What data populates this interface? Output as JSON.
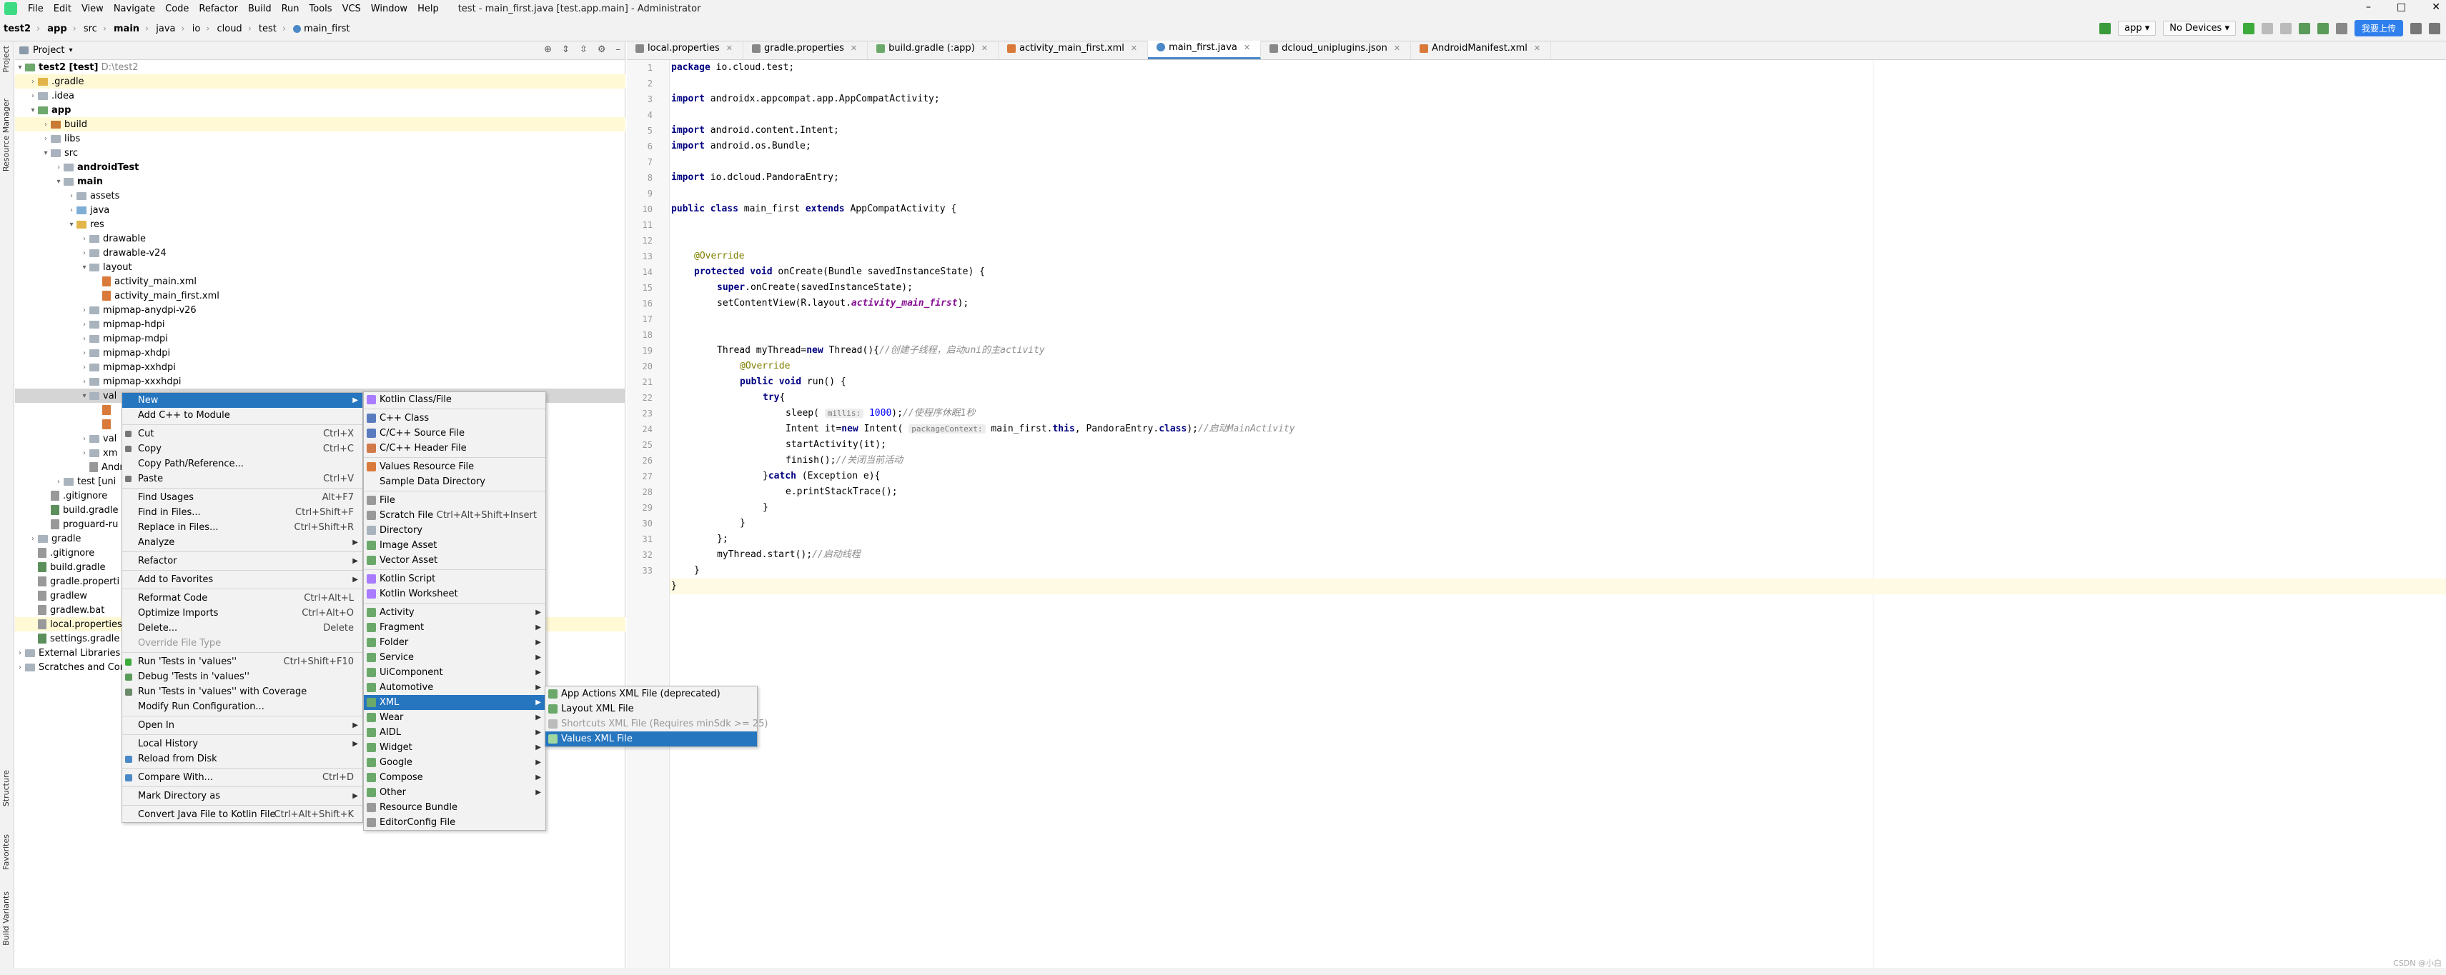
{
  "menubar": {
    "items": [
      "File",
      "Edit",
      "View",
      "Navigate",
      "Code",
      "Refactor",
      "Build",
      "Run",
      "Tools",
      "VCS",
      "Window",
      "Help"
    ],
    "title": "test - main_first.java [test.app.main] - Administrator"
  },
  "breadcrumbs": [
    "test2",
    "app",
    "src",
    "main",
    "java",
    "io",
    "cloud",
    "test",
    "main_first"
  ],
  "toolbar": {
    "config": "app",
    "device": "No Devices",
    "upload": "我要上传"
  },
  "side_tabs": {
    "project": "Project",
    "resource_manager": "Resource Manager",
    "structure": "Structure",
    "favorites": "Favorites",
    "build_variants": "Build Variants"
  },
  "project": {
    "header": "Project",
    "tree": [
      {
        "label": "test2 [test]",
        "hint": "D:\\test2",
        "bold": true
      },
      {
        "label": ".gradle"
      },
      {
        "label": ".idea"
      },
      {
        "label": "app",
        "bold": true
      },
      {
        "label": "build"
      },
      {
        "label": "libs"
      },
      {
        "label": "src"
      },
      {
        "label": "androidTest",
        "bold": true
      },
      {
        "label": "main",
        "bold": true
      },
      {
        "label": "assets"
      },
      {
        "label": "java"
      },
      {
        "label": "res"
      },
      {
        "label": "drawable"
      },
      {
        "label": "drawable-v24"
      },
      {
        "label": "layout"
      },
      {
        "label": "activity_main.xml"
      },
      {
        "label": "activity_main_first.xml"
      },
      {
        "label": "mipmap-anydpi-v26"
      },
      {
        "label": "mipmap-hdpi"
      },
      {
        "label": "mipmap-mdpi"
      },
      {
        "label": "mipmap-xhdpi"
      },
      {
        "label": "mipmap-xxhdpi"
      },
      {
        "label": "mipmap-xxxhdpi"
      },
      {
        "label": "val"
      },
      {
        "label": ""
      },
      {
        "label": ""
      },
      {
        "label": "val"
      },
      {
        "label": "xm"
      },
      {
        "label": "Andro"
      },
      {
        "label": "test [uni"
      },
      {
        "label": ".gitignore"
      },
      {
        "label": "build.gradle"
      },
      {
        "label": "proguard-ru"
      },
      {
        "label": "gradle"
      },
      {
        "label": ".gitignore"
      },
      {
        "label": "build.gradle"
      },
      {
        "label": "gradle.properti"
      },
      {
        "label": "gradlew"
      },
      {
        "label": "gradlew.bat"
      },
      {
        "label": "local.properties"
      },
      {
        "label": "settings.gradle"
      },
      {
        "label": "External Libraries"
      },
      {
        "label": "Scratches and Cor"
      }
    ]
  },
  "tabs": [
    "local.properties",
    "gradle.properties",
    "build.gradle (:app)",
    "activity_main_first.xml",
    "main_first.java",
    "dcloud_uniplugins.json",
    "AndroidManifest.xml"
  ],
  "code": {
    "line_numbers": [
      "1",
      "2",
      "3",
      "4",
      "5",
      "6",
      "7",
      "8",
      "9",
      "10",
      "11",
      "12",
      "13",
      "14",
      "15",
      "16",
      "17",
      "18",
      "19",
      "20",
      "21",
      "22",
      "23",
      "24",
      "25",
      "26",
      "27",
      "28",
      "29",
      "30",
      "31",
      "32",
      "33"
    ],
    "l1_kw": "package",
    "l1": " io.cloud.test;",
    "l3_kw": "import",
    "l3": " androidx.appcompat.app.AppCompatActivity;",
    "l5_kw": "import",
    "l5": " android.content.Intent;",
    "l6_kw": "import",
    "l6": " android.os.Bundle;",
    "l8_kw": "import",
    "l8": " io.dcloud.PandoraEntry;",
    "l10_kw1": "public class",
    "l10a": " main_first ",
    "l10_kw2": "extends",
    "l10b": " AppCompatActivity {",
    "l12": "@Override",
    "l13_kw": "protected void",
    "l13": " onCreate(Bundle savedInstanceState) {",
    "l14_kw": "super",
    "l14": ".onCreate(savedInstanceState);",
    "l15a": "setContentView(R.layout.",
    "l15b": "activity_main_first",
    "l15c": ");",
    "l18a": "Thread myThread=",
    "l18_kw": "new",
    "l18b": " Thread(){",
    "l18_c": "//创建子线程，启动uni的主activity",
    "l19": "@Override",
    "l20_kw": "public void",
    "l20": " run() {",
    "l21_kw": "try",
    "l21": "{",
    "l22a": "sleep( ",
    "l22_hint": "millis:",
    "l22_num": " 1000",
    "l22b": ");",
    "l22_c": "//使程序休眠1秒",
    "l23a": "Intent it=",
    "l23_kw": "new",
    "l23b": " Intent( ",
    "l23_hint": "packageContext:",
    "l23c": " main_first.",
    "l23_kw2": "this",
    "l23d": ", PandoraEntry.",
    "l23_kw3": "class",
    "l23e": ");",
    "l23_c": "//启动MainActivity",
    "l24": "startActivity(it);",
    "l25a": "finish();",
    "l25_c": "//关闭当前活动",
    "l26a": "}",
    "l26_kw": "catch",
    "l26b": " (Exception e){",
    "l27": "e.printStackTrace();",
    "l28": "}",
    "l29": "}",
    "l30": "};",
    "l31a": "myThread.start();",
    "l31_c": "//启动线程",
    "l32": "}",
    "l33": "}"
  },
  "context_menu": {
    "items": [
      {
        "label": "New",
        "sub": true
      },
      {
        "label": "Add C++ to Module"
      },
      {
        "label": "Cut",
        "shortcut": "Ctrl+X"
      },
      {
        "label": "Copy",
        "shortcut": "Ctrl+C"
      },
      {
        "label": "Copy Path/Reference..."
      },
      {
        "label": "Paste",
        "shortcut": "Ctrl+V"
      },
      {
        "label": "Find Usages",
        "shortcut": "Alt+F7"
      },
      {
        "label": "Find in Files...",
        "shortcut": "Ctrl+Shift+F"
      },
      {
        "label": "Replace in Files...",
        "shortcut": "Ctrl+Shift+R"
      },
      {
        "label": "Analyze",
        "sub": true
      },
      {
        "label": "Refactor",
        "sub": true
      },
      {
        "label": "Add to Favorites",
        "sub": true
      },
      {
        "label": "Reformat Code",
        "shortcut": "Ctrl+Alt+L"
      },
      {
        "label": "Optimize Imports",
        "shortcut": "Ctrl+Alt+O"
      },
      {
        "label": "Delete...",
        "shortcut": "Delete"
      },
      {
        "label": "Override File Type"
      },
      {
        "label": "Run 'Tests in 'values''",
        "shortcut": "Ctrl+Shift+F10"
      },
      {
        "label": "Debug 'Tests in 'values''"
      },
      {
        "label": "Run 'Tests in 'values'' with Coverage"
      },
      {
        "label": "Modify Run Configuration..."
      },
      {
        "label": "Open In",
        "sub": true
      },
      {
        "label": "Local History",
        "sub": true
      },
      {
        "label": "Reload from Disk"
      },
      {
        "label": "Compare With...",
        "shortcut": "Ctrl+D"
      },
      {
        "label": "Mark Directory as",
        "sub": true
      },
      {
        "label": "Convert Java File to Kotlin File",
        "shortcut": "Ctrl+Alt+Shift+K"
      }
    ]
  },
  "new_menu": {
    "items": [
      {
        "label": "Kotlin Class/File"
      },
      {
        "label": "C++ Class"
      },
      {
        "label": "C/C++ Source File"
      },
      {
        "label": "C/C++ Header File"
      },
      {
        "label": "Values Resource File"
      },
      {
        "label": "Sample Data Directory"
      },
      {
        "label": "File"
      },
      {
        "label": "Scratch File",
        "shortcut": "Ctrl+Alt+Shift+Insert"
      },
      {
        "label": "Directory"
      },
      {
        "label": "Image Asset"
      },
      {
        "label": "Vector Asset"
      },
      {
        "label": "Kotlin Script"
      },
      {
        "label": "Kotlin Worksheet"
      },
      {
        "label": "Activity"
      },
      {
        "label": "Fragment"
      },
      {
        "label": "Folder"
      },
      {
        "label": "Service"
      },
      {
        "label": "UiComponent"
      },
      {
        "label": "Automotive"
      },
      {
        "label": "XML"
      },
      {
        "label": "Wear"
      },
      {
        "label": "AIDL"
      },
      {
        "label": "Widget"
      },
      {
        "label": "Google"
      },
      {
        "label": "Compose"
      },
      {
        "label": "Other"
      },
      {
        "label": "Resource Bundle"
      },
      {
        "label": "EditorConfig File"
      }
    ]
  },
  "xml_menu": {
    "items": [
      {
        "label": "App Actions XML File (deprecated)"
      },
      {
        "label": "Layout XML File"
      },
      {
        "label": "Shortcuts XML File (Requires minSdk >= 25)"
      },
      {
        "label": "Values XML File"
      }
    ]
  },
  "watermark": "CSDN @小白"
}
